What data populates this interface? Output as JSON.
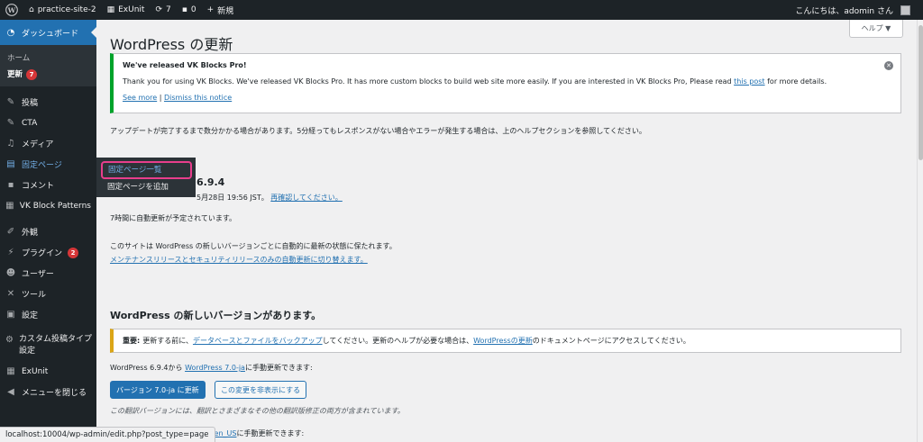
{
  "adminbar": {
    "site_name": "practice-site-2",
    "exunit": "ExUnit",
    "updates_count": "7",
    "comments_count": "0",
    "new_label": "新規",
    "greeting": "こんにちは、adomin さん"
  },
  "sidebar": {
    "dashboard": "ダッシュボード",
    "home": "ホーム",
    "updates": "更新",
    "updates_badge": "7",
    "posts": "投稿",
    "cta": "CTA",
    "media": "メディア",
    "pages": "固定ページ",
    "comments": "コメント",
    "vk_block_patterns": "VK Block Patterns",
    "appearance": "外観",
    "plugins": "プラグイン",
    "plugins_badge": "2",
    "users": "ユーザー",
    "tools": "ツール",
    "settings": "設定",
    "custom_post_1": "カスタム投稿タイプ",
    "custom_post_2": "設定",
    "exunit": "ExUnit",
    "collapse": "メニューを閉じる"
  },
  "flyout": {
    "all_pages": "固定ページ一覧",
    "add_page": "固定ページを追加"
  },
  "main": {
    "title": "WordPress の更新",
    "help": "ヘルプ ▼",
    "notice": {
      "title": "We've released VK Blocks Pro!",
      "body_before": "Thank you for using VK Blocks. We've released VK Blocks Pro. It has more custom blocks to build web site more easily. If you are interested in VK Blocks Pro, Please read ",
      "body_link": "this post",
      "body_after": " for more details.",
      "see_more": "See more",
      "separator": " | ",
      "dismiss": "Dismiss this notice"
    },
    "intro": "アップデートが完了するまで数分かかる場合があります。5分経ってもレスポンスがない場合やエラーが発生する場合は、上のヘルプセクションを参照してください。",
    "version_visible": "6.9.4",
    "last_checked_visible": "5月28日 19:56 JST。",
    "recheck": "再確認してください。",
    "auto_update_scheduled": "7時間に自動更新が予定されています。",
    "auto_update_info": "このサイトは WordPress の新しいバージョンごとに自動的に最新の状態に保たれます。",
    "switch_link": "メンテナンスリリースとセキュリティリリースのみの自動更新に切り替えます。",
    "new_version_heading": "WordPress の新しいバージョンがあります。",
    "warning": {
      "label": "重要:",
      "text1": " 更新する前に、",
      "link1": "データベースとファイルをバックアップ",
      "text2": "してください。更新のヘルプが必要な場合は、",
      "link2": "WordPressの更新",
      "text3": "のドキュメントページにアクセスしてください。"
    },
    "manual_update_prefix": "WordPress 6.9.4から ",
    "manual_update_link": "WordPress 7.0-ja",
    "manual_update_suffix": "に手動更新できます:",
    "update_button": "バージョン 7.0-ja に更新",
    "hide_button": "この変更を非表示にする",
    "translation_note": "この翻訳バージョンには、翻訳とさまざまなその他の翻訳版修正の両方が含まれています。",
    "manual_update_en_link": "ress 7.0-en_US",
    "manual_update_en_suffix": "に手動更新できます:"
  },
  "statusbar": {
    "url": "localhost:10004/wp-admin/edit.php?post_type=page"
  }
}
